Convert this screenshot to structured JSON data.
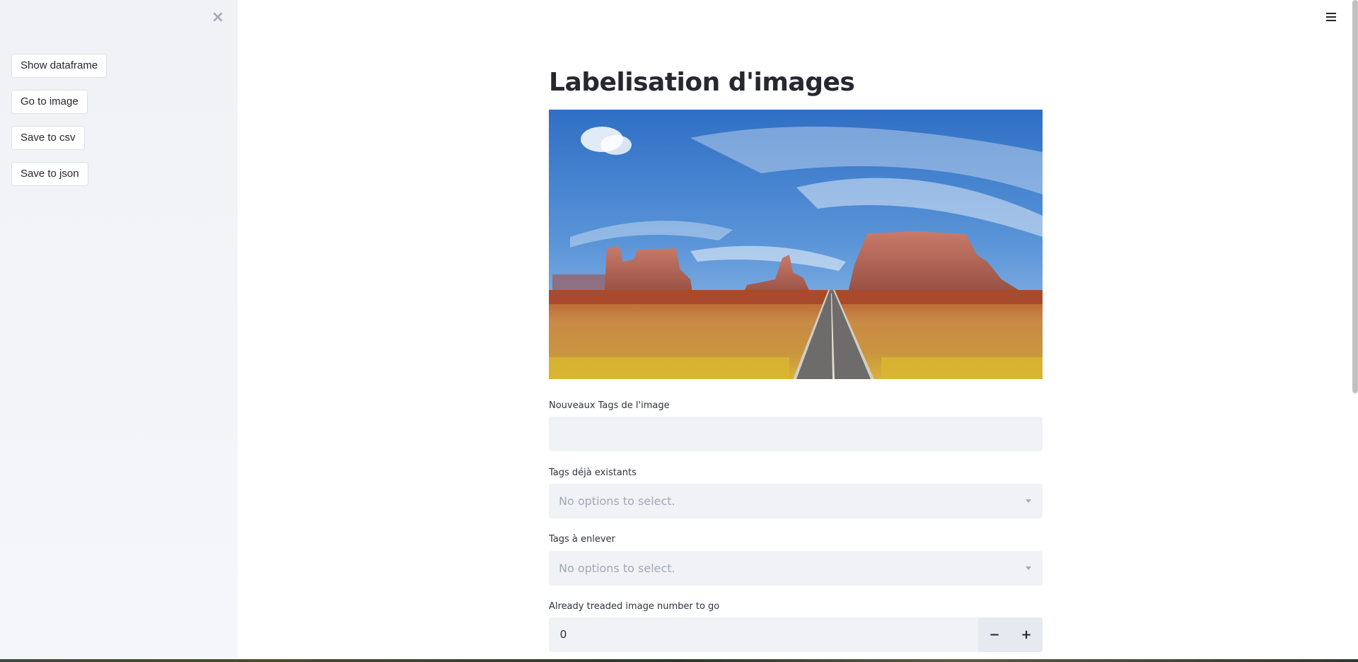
{
  "sidebar": {
    "close_symbol": "×",
    "buttons": [
      {
        "label": "Show dataframe"
      },
      {
        "label": "Go to image"
      },
      {
        "label": "Save to csv"
      },
      {
        "label": "Save to json"
      }
    ]
  },
  "main": {
    "title": "Labelisation d'images",
    "fields": {
      "new_tags": {
        "label": "Nouveaux Tags de l'image",
        "value": ""
      },
      "existing_tags": {
        "label": "Tags déjà existants",
        "placeholder": "No options to select."
      },
      "remove_tags": {
        "label": "Tags à enlever",
        "placeholder": "No options to select."
      },
      "image_number": {
        "label": "Already treaded image number to go",
        "value": "0",
        "minus": "−",
        "plus": "+"
      }
    }
  },
  "icons": {
    "close": "close-icon",
    "menu": "hamburger-menu-icon",
    "dropdown": "chevron-down-icon"
  }
}
